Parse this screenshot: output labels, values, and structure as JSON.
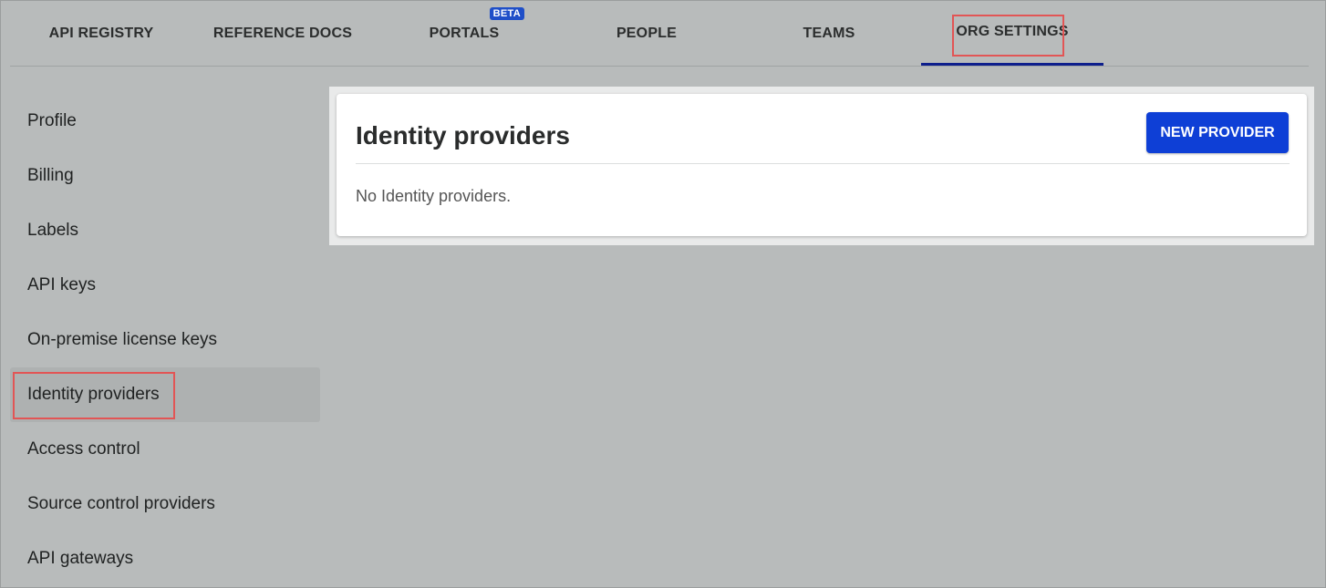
{
  "topnav": {
    "tabs": [
      {
        "label": "API REGISTRY"
      },
      {
        "label": "REFERENCE DOCS"
      },
      {
        "label": "PORTALS",
        "badge": "BETA"
      },
      {
        "label": "PEOPLE"
      },
      {
        "label": "TEAMS"
      },
      {
        "label": "ORG SETTINGS",
        "active": true
      }
    ]
  },
  "sidebar": {
    "items": [
      {
        "label": "Profile"
      },
      {
        "label": "Billing"
      },
      {
        "label": "Labels"
      },
      {
        "label": "API keys"
      },
      {
        "label": "On-premise license keys"
      },
      {
        "label": "Identity providers",
        "active": true
      },
      {
        "label": "Access control"
      },
      {
        "label": "Source control providers"
      },
      {
        "label": "API gateways"
      }
    ]
  },
  "main": {
    "title": "Identity providers",
    "new_button_label": "NEW PROVIDER",
    "empty_message": "No Identity providers."
  },
  "colors": {
    "background": "#b8bbbb",
    "accent_button": "#0e3fd6",
    "active_tab_underline": "#0d1e8c",
    "highlight_box": "#e25555",
    "beta_badge": "#1f4fc8"
  }
}
